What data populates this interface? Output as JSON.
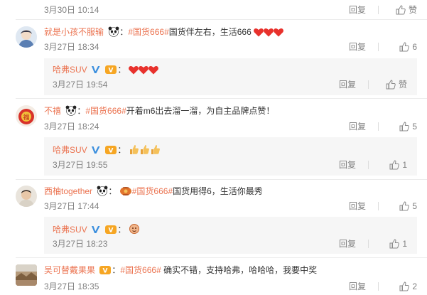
{
  "top": {
    "time": "3月30日 10:14",
    "reply_label": "回复",
    "like_label": "赞"
  },
  "comments": [
    {
      "user": "就是小孩不服输",
      "topic": "#国货666#",
      "text": "国货伴左右，生活666",
      "time": "3月27日 18:34",
      "reply_label": "回复",
      "likes": "6",
      "sub": {
        "user": "哈弗SUV",
        "time": "3月27日 19:54",
        "reply_label": "回复",
        "like_label": "赞"
      }
    },
    {
      "user": "不禧",
      "topic": "#国货666#",
      "text": "开着m6出去溜一溜，为自主品牌点赞！",
      "time": "3月27日 18:24",
      "reply_label": "回复",
      "likes": "5",
      "sub": {
        "user": "哈弗SUV",
        "time": "3月27日 19:55",
        "reply_label": "回复",
        "likes": "1"
      }
    },
    {
      "user": "西柚together",
      "topic": "#国货666#",
      "text": "国货用得6，生活你最秀",
      "time": "3月27日 17:44",
      "reply_label": "回复",
      "likes": "5",
      "sub": {
        "user": "哈弗SUV",
        "time": "3月27日 18:23",
        "reply_label": "回复",
        "likes": "1"
      }
    },
    {
      "user": "吴可替戴果果",
      "topic": "#国货666#",
      "text": " 确实不错，支持哈弗，哈哈哈，我要中奖",
      "time": "3月27日 18:35",
      "reply_label": "回复",
      "likes": "2"
    }
  ],
  "colors": {
    "link": "#eb7350",
    "text": "#333333",
    "meta": "#808080",
    "subbox": "#f6f6f6",
    "verified": "#3b8fde"
  },
  "icons": [
    "thumb-up-icon",
    "heart-icon",
    "verified-icon",
    "panda-icon",
    "thumbs-emoji-icon",
    "lantern-emoji-icon",
    "member-badge-icon"
  ]
}
